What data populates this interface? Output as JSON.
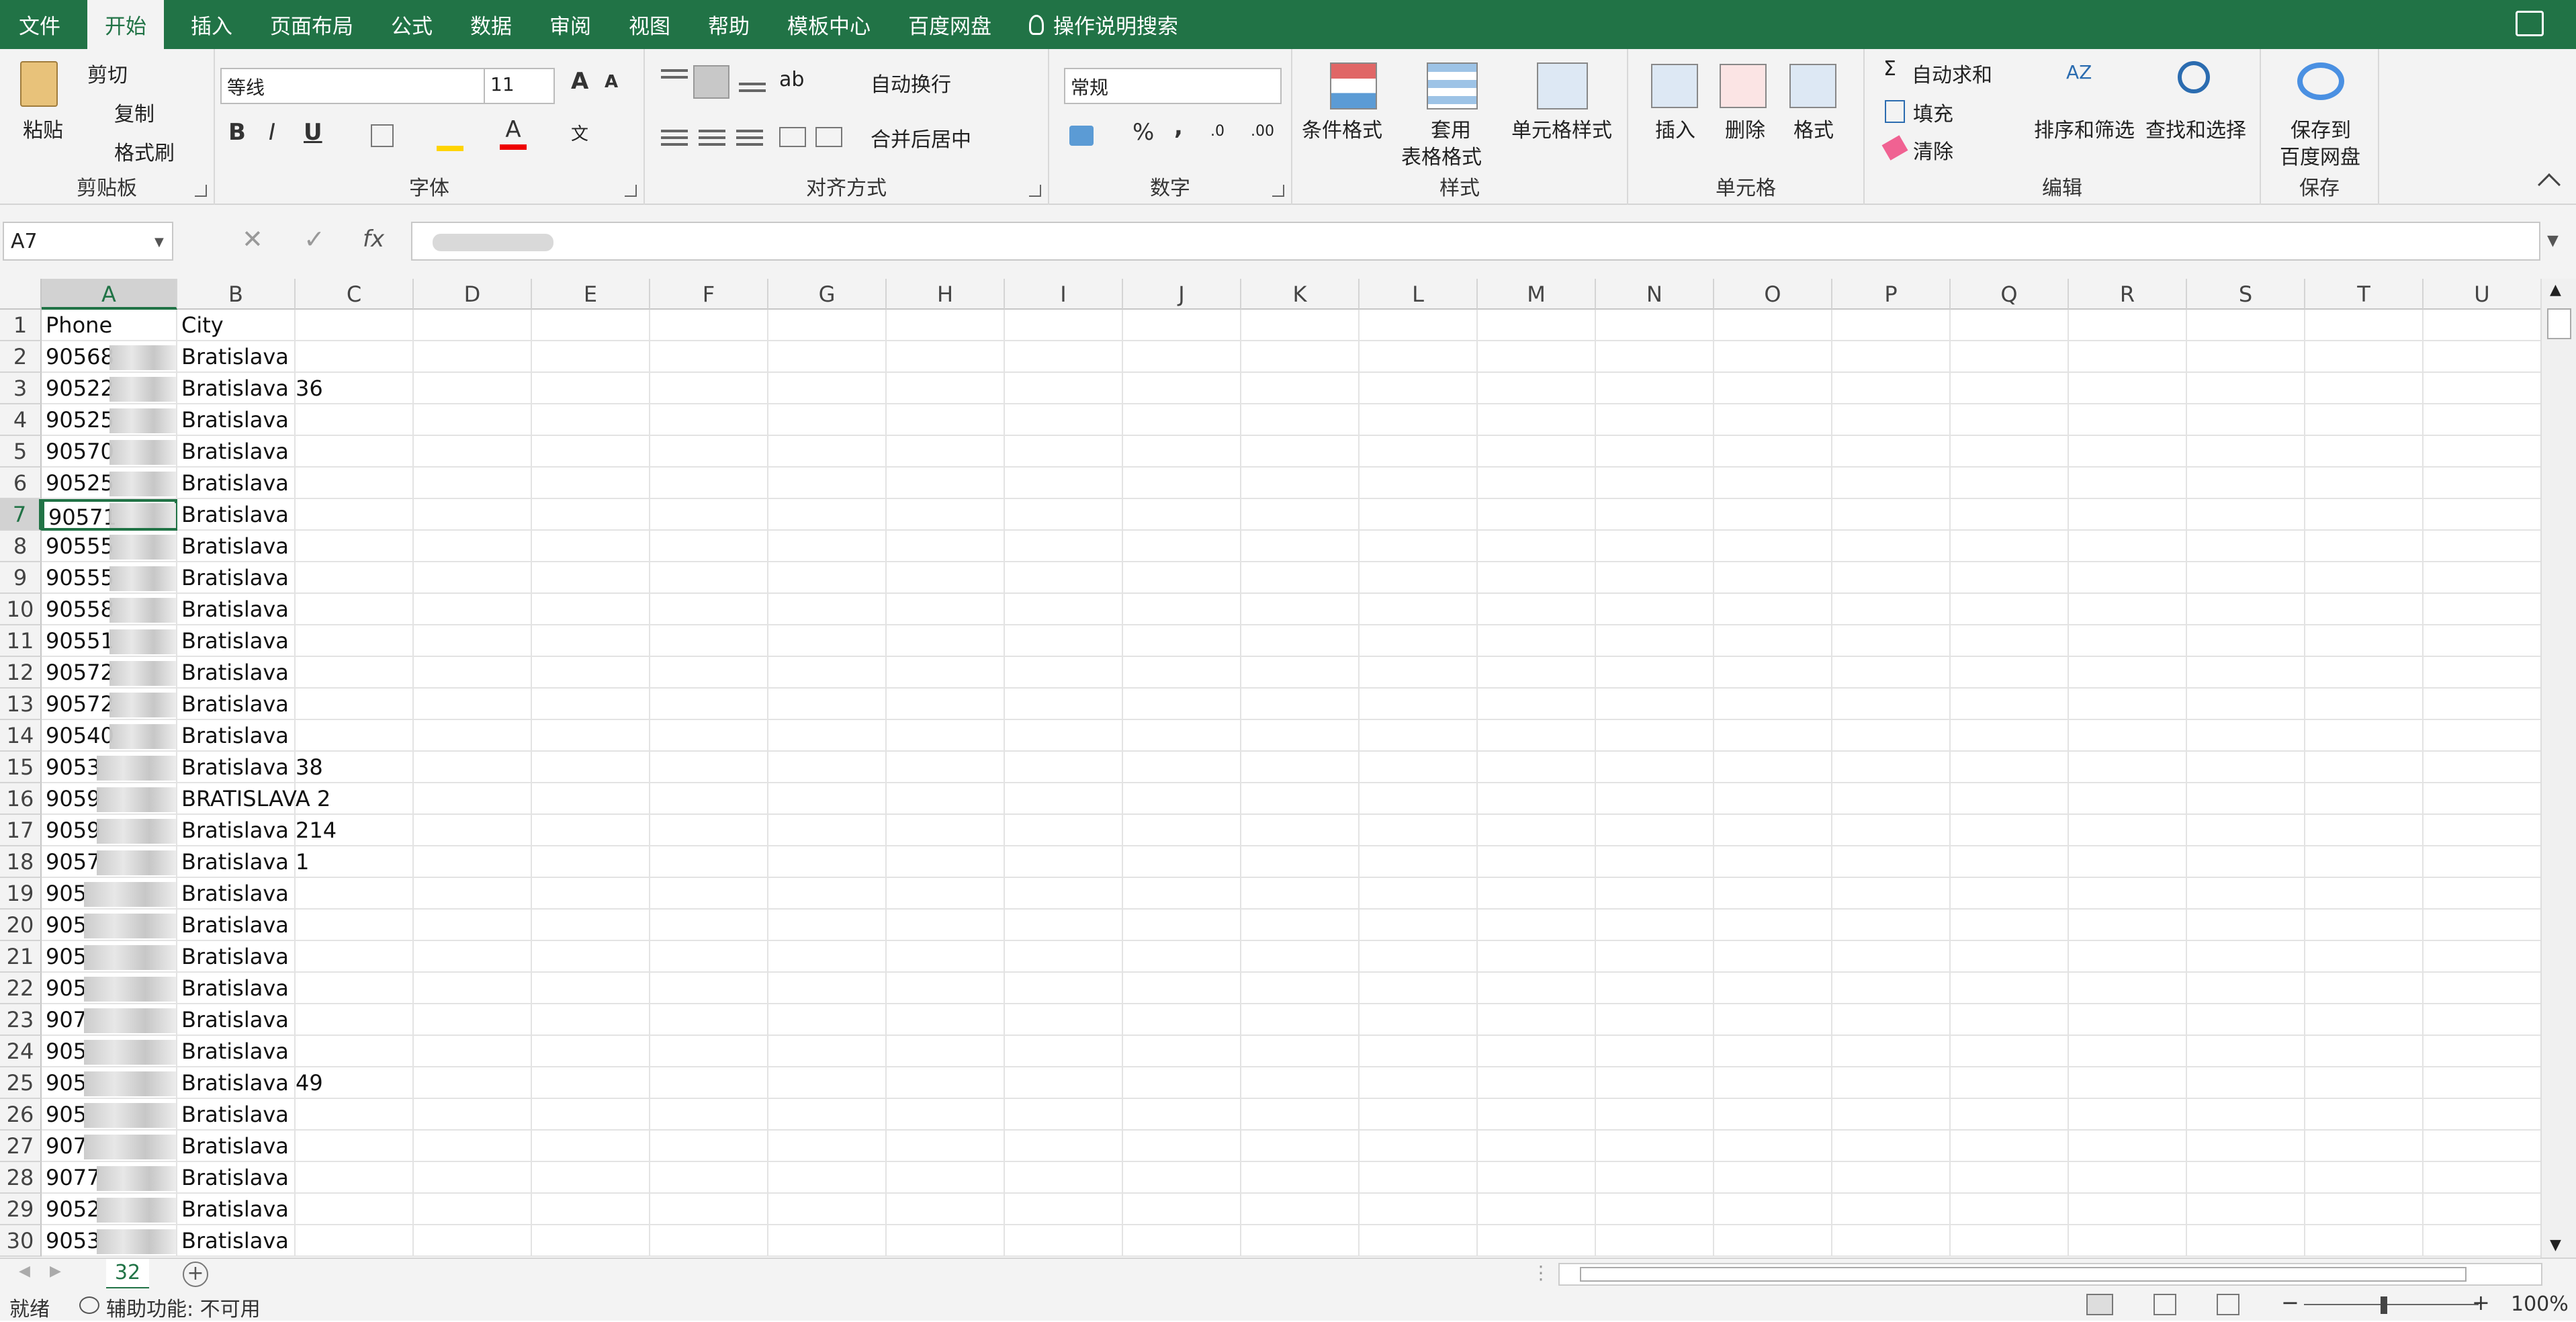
{
  "menu": {
    "tabs": [
      "文件",
      "开始",
      "插入",
      "页面布局",
      "公式",
      "数据",
      "审阅",
      "视图",
      "帮助",
      "模板中心",
      "百度网盘"
    ],
    "tell_me": "操作说明搜索"
  },
  "ribbon": {
    "clipboard": {
      "paste": "粘贴",
      "cut": "剪切",
      "copy": "复制",
      "format_painter": "格式刷",
      "label": "剪贴板"
    },
    "font": {
      "name": "等线",
      "size": "11",
      "label": "字体",
      "bold": "B",
      "italic": "I",
      "underline": "U",
      "grow": "A",
      "shrink": "A"
    },
    "alignment": {
      "wrap": "自动换行",
      "merge": "合并后居中",
      "label": "对齐方式"
    },
    "number": {
      "format": "常规",
      "percent": "%",
      "comma": ",",
      "label": "数字"
    },
    "styles": {
      "conditional": "条件格式",
      "table_line1": "套用",
      "table_line2": "表格格式",
      "cell_styles": "单元格样式",
      "label": "样式"
    },
    "cells": {
      "insert": "插入",
      "delete": "删除",
      "format": "格式",
      "label": "单元格"
    },
    "editing": {
      "autosum": "自动求和",
      "fill": "填充",
      "clear": "清除",
      "sort": "排序和筛选",
      "find": "查找和选择",
      "label": "编辑"
    },
    "save": {
      "line1": "保存到",
      "line2": "百度网盘",
      "label": "保存"
    }
  },
  "formula_bar": {
    "name_box": "A7",
    "fx": "fx"
  },
  "columns": [
    "A",
    "B",
    "C",
    "D",
    "E",
    "F",
    "G",
    "H",
    "I",
    "J",
    "K",
    "L",
    "M",
    "N",
    "O",
    "P",
    "Q",
    "R",
    "S",
    "T",
    "U"
  ],
  "rows": [
    {
      "n": "1",
      "a": "Phone",
      "b": "City"
    },
    {
      "n": "2",
      "a": "90568",
      "b": "Bratislava"
    },
    {
      "n": "3",
      "a": "90522",
      "b": "Bratislava 36"
    },
    {
      "n": "4",
      "a": "90525",
      "b": "Bratislava"
    },
    {
      "n": "5",
      "a": "90570",
      "b": "Bratislava"
    },
    {
      "n": "6",
      "a": "90525",
      "b": "Bratislava"
    },
    {
      "n": "7",
      "a": "90571",
      "b": "Bratislava"
    },
    {
      "n": "8",
      "a": "90555",
      "b": "Bratislava"
    },
    {
      "n": "9",
      "a": "90555",
      "b": "Bratislava"
    },
    {
      "n": "10",
      "a": "90558",
      "b": "Bratislava"
    },
    {
      "n": "11",
      "a": "90551",
      "b": "Bratislava"
    },
    {
      "n": "12",
      "a": "90572",
      "b": "Bratislava"
    },
    {
      "n": "13",
      "a": "90572",
      "b": "Bratislava"
    },
    {
      "n": "14",
      "a": "90540",
      "b": "Bratislava"
    },
    {
      "n": "15",
      "a": "9053",
      "b": "Bratislava 38"
    },
    {
      "n": "16",
      "a": "9059",
      "b": "BRATISLAVA 2"
    },
    {
      "n": "17",
      "a": "9059",
      "b": "Bratislava 214"
    },
    {
      "n": "18",
      "a": "9057",
      "b": "Bratislava 1"
    },
    {
      "n": "19",
      "a": "905",
      "b": "Bratislava"
    },
    {
      "n": "20",
      "a": "905",
      "b": "Bratislava"
    },
    {
      "n": "21",
      "a": "905",
      "b": "Bratislava"
    },
    {
      "n": "22",
      "a": "905",
      "b": "Bratislava"
    },
    {
      "n": "23",
      "a": "907",
      "b": "Bratislava"
    },
    {
      "n": "24",
      "a": "905",
      "b": "Bratislava"
    },
    {
      "n": "25",
      "a": "905",
      "b": "Bratislava 49"
    },
    {
      "n": "26",
      "a": "905",
      "b": "Bratislava"
    },
    {
      "n": "27",
      "a": "907",
      "b": "Bratislava"
    },
    {
      "n": "28",
      "a": "9077",
      "b": "Bratislava"
    },
    {
      "n": "29",
      "a": "9052",
      "b": "Bratislava"
    },
    {
      "n": "30",
      "a": "9053",
      "b": "Bratislava"
    }
  ],
  "sheet_tab": "32",
  "status": {
    "ready": "就绪",
    "accessibility": "辅助功能: 不可用",
    "zoom": "100%"
  }
}
